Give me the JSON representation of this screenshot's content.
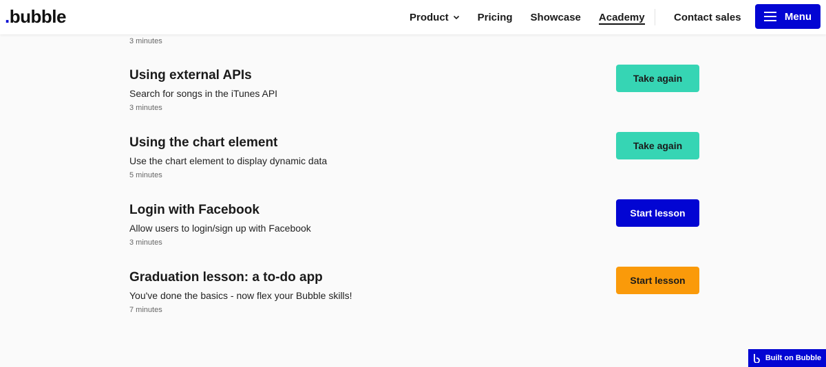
{
  "nav": {
    "logo_dot": ".",
    "logo_text": "bubble",
    "links": [
      {
        "label": "Product"
      },
      {
        "label": "Pricing"
      },
      {
        "label": "Showcase"
      },
      {
        "label": "Academy"
      }
    ],
    "contact": "Contact sales",
    "menu": "Menu"
  },
  "previous_lesson_duration": "3 minutes",
  "lessons": [
    {
      "title": "Using external APIs",
      "desc": "Search for songs in the iTunes API",
      "duration": "3 minutes",
      "button": "Take again",
      "button_color": "#36d5b4"
    },
    {
      "title": "Using the chart element",
      "desc": "Use the chart element to display dynamic data",
      "duration": "5 minutes",
      "button": "Take again",
      "button_color": "#36d5b4"
    },
    {
      "title": "Login with Facebook",
      "desc": "Allow users to login/sign up with Facebook",
      "duration": "3 minutes",
      "button": "Start lesson",
      "button_color": "#0205d3"
    },
    {
      "title": "Graduation lesson: a to-do app",
      "desc": "You've done the basics - now flex your Bubble skills!",
      "duration": "7 minutes",
      "button": "Start lesson",
      "button_color": "#fa9a0a"
    }
  ],
  "badge": "Built on Bubble",
  "colors": {
    "brand": "#0205d3",
    "teal": "#36d5b4",
    "orange": "#fa9a0a"
  }
}
